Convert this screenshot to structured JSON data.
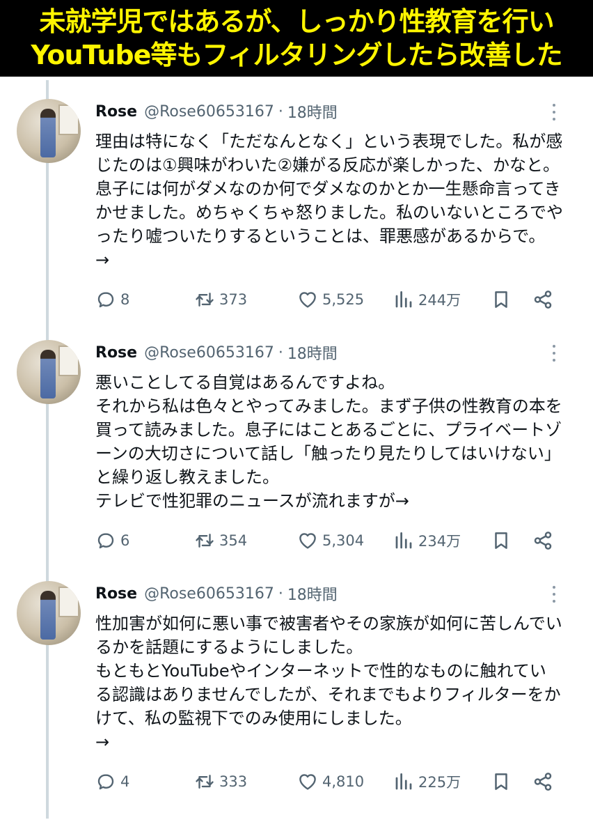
{
  "banner": {
    "line1": "未就学児ではあるが、しっかり性教育を行い",
    "line2": "YouTube等もフィルタリングしたら改善した"
  },
  "tweets": [
    {
      "name": "Rose",
      "handle": "@Rose60653167",
      "separator": "·",
      "time": "18時間",
      "lines": [
        "理由は特になく「ただなんとなく」という表現でした。私が感",
        "じたのは①興味がわいた②嫌がる反応が楽しかった、かなと。",
        "息子には何がダメなのか何でダメなのかとか一生懸命言ってき",
        "かせました。めちゃくちゃ怒りました。私のいないところでや",
        "ったり嘘ついたりするということは、罪悪感があるからで。",
        "→"
      ],
      "replies": "8",
      "retweets": "373",
      "likes": "5,525",
      "views": "244万"
    },
    {
      "name": "Rose",
      "handle": "@Rose60653167",
      "separator": "·",
      "time": "18時間",
      "lines": [
        "悪いことしてる自覚はあるんですよね。",
        "それから私は色々とやってみました。まず子供の性教育の本を",
        "買って読みました。息子にはことあるごとに、プライベートゾ",
        "ーンの大切さについて話し「触ったり見たりしてはいけない」",
        "と繰り返し教えました。",
        "テレビで性犯罪のニュースが流れますが→"
      ],
      "replies": "6",
      "retweets": "354",
      "likes": "5,304",
      "views": "234万"
    },
    {
      "name": "Rose",
      "handle": "@Rose60653167",
      "separator": "·",
      "time": "18時間",
      "lines": [
        "性加害が如何に悪い事で被害者やその家族が如何に苦しんでい",
        "るかを話題にするようにしました。",
        "もともとYouTubeやインターネットで性的なものに触れてい",
        "る認識はありませんでしたが、それまでもよりフィルターをか",
        "けて、私の監視下でのみ使用にしました。",
        "→"
      ],
      "replies": "4",
      "retweets": "333",
      "likes": "4,810",
      "views": "225万"
    }
  ],
  "colors": {
    "banner_bg": "#000000",
    "banner_text": "#fff500",
    "text": "#0f1419",
    "muted": "#536471",
    "thread_line": "#cfd9de"
  },
  "icons": [
    "reply-icon",
    "retweet-icon",
    "like-icon",
    "views-icon",
    "bookmark-icon",
    "share-icon",
    "more-icon"
  ]
}
